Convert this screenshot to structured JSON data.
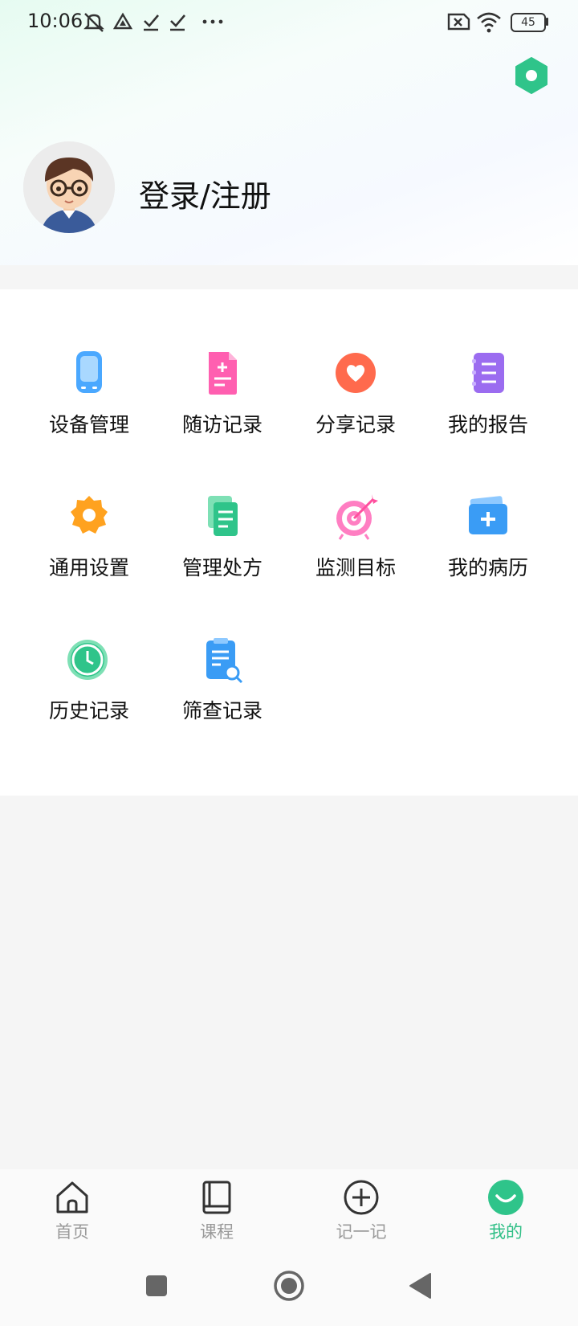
{
  "status_bar": {
    "time": "10:06",
    "battery": "45",
    "icons": [
      "mute-icon",
      "triangle-icon",
      "check-icon",
      "check-icon",
      "more-dots-icon",
      "no-sim-icon",
      "wifi-icon",
      "battery-icon"
    ]
  },
  "profile": {
    "login_label": "登录/注册",
    "settings_icon": "hexagon-settings-icon"
  },
  "menu": {
    "items": [
      {
        "label": "设备管理",
        "icon": "device-icon"
      },
      {
        "label": "随访记录",
        "icon": "follow-up-doc-icon"
      },
      {
        "label": "分享记录",
        "icon": "heart-icon"
      },
      {
        "label": "我的报告",
        "icon": "report-icon"
      },
      {
        "label": "通用设置",
        "icon": "gear-icon"
      },
      {
        "label": "管理处方",
        "icon": "prescription-icon"
      },
      {
        "label": "监测目标",
        "icon": "target-icon"
      },
      {
        "label": "我的病历",
        "icon": "medical-record-icon"
      },
      {
        "label": "历史记录",
        "icon": "clock-icon"
      },
      {
        "label": "筛查记录",
        "icon": "screening-icon"
      }
    ]
  },
  "tabs": [
    {
      "label": "首页",
      "icon": "home-icon"
    },
    {
      "label": "课程",
      "icon": "book-icon"
    },
    {
      "label": "记一记",
      "icon": "plus-circle-icon"
    },
    {
      "label": "我的",
      "icon": "smile-icon",
      "active": true
    }
  ],
  "colors": {
    "accent": "#2fbf86",
    "tab_inactive": "#9a9a9a"
  }
}
